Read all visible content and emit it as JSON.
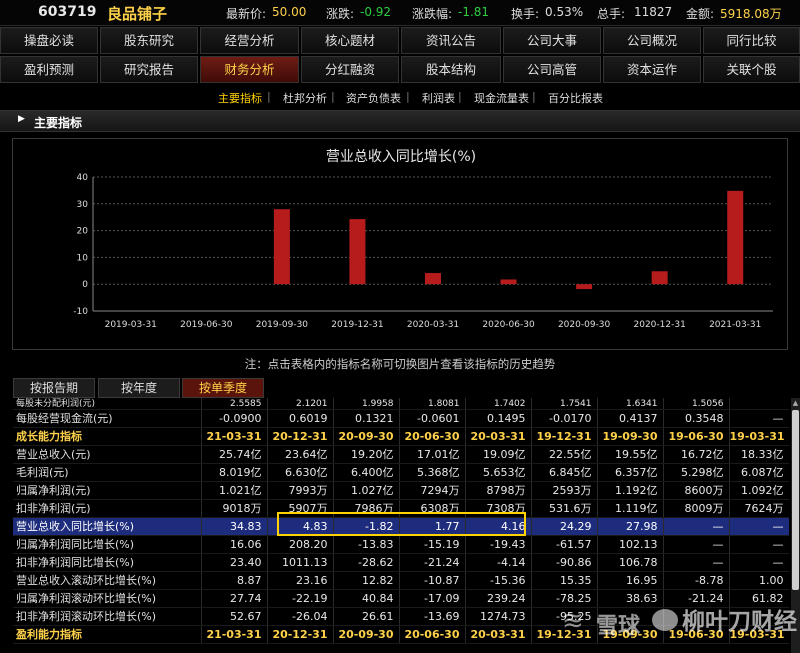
{
  "quote": {
    "code": "603719",
    "name": "良品铺子",
    "latest_label": "最新价:",
    "latest_value": "50.00",
    "change_label": "涨跌:",
    "change_value": "-0.92",
    "pct_label": "涨跌幅:",
    "pct_value": "-1.81",
    "turnover_label": "换手:",
    "turnover_value": "0.53%",
    "vol_label": "总手:",
    "vol_value": "11827",
    "amount_label": "金额:",
    "amount_value": "5918.08万"
  },
  "nav_row1": [
    "操盘必读",
    "股东研究",
    "经营分析",
    "核心题材",
    "资讯公告",
    "公司大事",
    "公司概况",
    "同行比较"
  ],
  "nav_row2": [
    "盈利预测",
    "研究报告",
    "财务分析",
    "分红融资",
    "股本结构",
    "公司高管",
    "资本运作",
    "关联个股"
  ],
  "nav_active": "财务分析",
  "subtabs": [
    "主要指标",
    "杜邦分析",
    "资产负债表",
    "利润表",
    "现金流量表",
    "百分比报表"
  ],
  "subtab_sep": "|",
  "section_header": "主要指标",
  "chart_data": {
    "type": "bar",
    "title": "营业总收入同比增长(%)",
    "categories": [
      "2019-03-31",
      "2019-06-30",
      "2019-09-30",
      "2019-12-31",
      "2020-03-31",
      "2020-06-30",
      "2020-09-30",
      "2020-12-31",
      "2021-03-31"
    ],
    "values": [
      null,
      null,
      27.98,
      24.29,
      4.16,
      1.77,
      -1.82,
      4.83,
      34.83
    ],
    "ylim": [
      -10,
      40
    ],
    "yticks": [
      "40",
      "30",
      "20",
      "10",
      "0",
      "-10"
    ],
    "bar_color": "#b71c1c",
    "grid": true
  },
  "note": "注：点击表格内的指标名称可切换图片查看该指标的历史趋势",
  "data_tabs": [
    "按报告期",
    "按年度",
    "按单季度"
  ],
  "data_tab_active": "按单季度",
  "table": {
    "rows": [
      {
        "kind": "partial",
        "label": "每股未分配利润(元)",
        "values": [
          "2.5585",
          "2.1201",
          "1.9958",
          "1.8081",
          "1.7402",
          "1.7541",
          "1.6341",
          "1.5056",
          ""
        ]
      },
      {
        "kind": "data",
        "label": "每股经营现金流(元)",
        "values": [
          "-0.0900",
          "0.6019",
          "0.1321",
          "-0.0601",
          "0.1495",
          "-0.0170",
          "0.4137",
          "0.3548",
          "—"
        ]
      },
      {
        "kind": "section",
        "label": "成长能力指标",
        "values": [
          "21-03-31",
          "20-12-31",
          "20-09-30",
          "20-06-30",
          "20-03-31",
          "19-12-31",
          "19-09-30",
          "19-06-30",
          "19-03-31"
        ]
      },
      {
        "kind": "data",
        "label": "营业总收入(元)",
        "values": [
          "25.74亿",
          "23.64亿",
          "19.20亿",
          "17.01亿",
          "19.09亿",
          "22.55亿",
          "19.55亿",
          "16.72亿",
          "18.33亿"
        ]
      },
      {
        "kind": "data",
        "label": "毛利润(元)",
        "values": [
          "8.019亿",
          "6.630亿",
          "6.400亿",
          "5.368亿",
          "5.653亿",
          "6.845亿",
          "6.357亿",
          "5.298亿",
          "6.087亿"
        ]
      },
      {
        "kind": "data",
        "label": "归属净利润(元)",
        "values": [
          "1.021亿",
          "7993万",
          "1.027亿",
          "7294万",
          "8798万",
          "2593万",
          "1.192亿",
          "8600万",
          "1.092亿"
        ]
      },
      {
        "kind": "data",
        "label": "扣非净利润(元)",
        "values": [
          "9018万",
          "5907万",
          "7986万",
          "6308万",
          "7308万",
          "531.6万",
          "1.119亿",
          "8009万",
          "7624万"
        ]
      },
      {
        "kind": "hl",
        "label": "营业总收入同比增长(%)",
        "values": [
          "34.83",
          "4.83",
          "-1.82",
          "1.77",
          "4.16",
          "24.29",
          "27.98",
          "—",
          "—"
        ]
      },
      {
        "kind": "data",
        "label": "归属净利润同比增长(%)",
        "values": [
          "16.06",
          "208.20",
          "-13.83",
          "-15.19",
          "-19.43",
          "-61.57",
          "102.13",
          "—",
          "—"
        ]
      },
      {
        "kind": "data",
        "label": "扣非净利润同比增长(%)",
        "values": [
          "23.40",
          "1011.13",
          "-28.62",
          "-21.24",
          "-4.14",
          "-90.86",
          "106.78",
          "—",
          "—"
        ]
      },
      {
        "kind": "data",
        "label": "营业总收入滚动环比增长(%)",
        "values": [
          "8.87",
          "23.16",
          "12.82",
          "-10.87",
          "-15.36",
          "15.35",
          "16.95",
          "-8.78",
          "1.00"
        ]
      },
      {
        "kind": "data",
        "label": "归属净利润滚动环比增长(%)",
        "values": [
          "27.74",
          "-22.19",
          "40.84",
          "-17.09",
          "239.24",
          "-78.25",
          "38.63",
          "-21.24",
          "61.82"
        ]
      },
      {
        "kind": "data",
        "label": "扣非净利润滚动环比增长(%)",
        "values": [
          "52.67",
          "-26.04",
          "26.61",
          "-13.69",
          "1274.73",
          "-95.25",
          "",
          "",
          ""
        ]
      },
      {
        "kind": "section",
        "label": "盈利能力指标",
        "values": [
          "21-03-31",
          "20-12-31",
          "20-09-30",
          "20-06-30",
          "20-03-31",
          "19-12-31",
          "19-09-30",
          "19-06-30",
          "19-03-31"
        ]
      }
    ]
  },
  "watermark": {
    "text1": "雪球",
    "text2": "柳叶刀财经",
    "logo_icon": "snowball-logo-icon",
    "wechat_icon": "wechat-icon"
  }
}
